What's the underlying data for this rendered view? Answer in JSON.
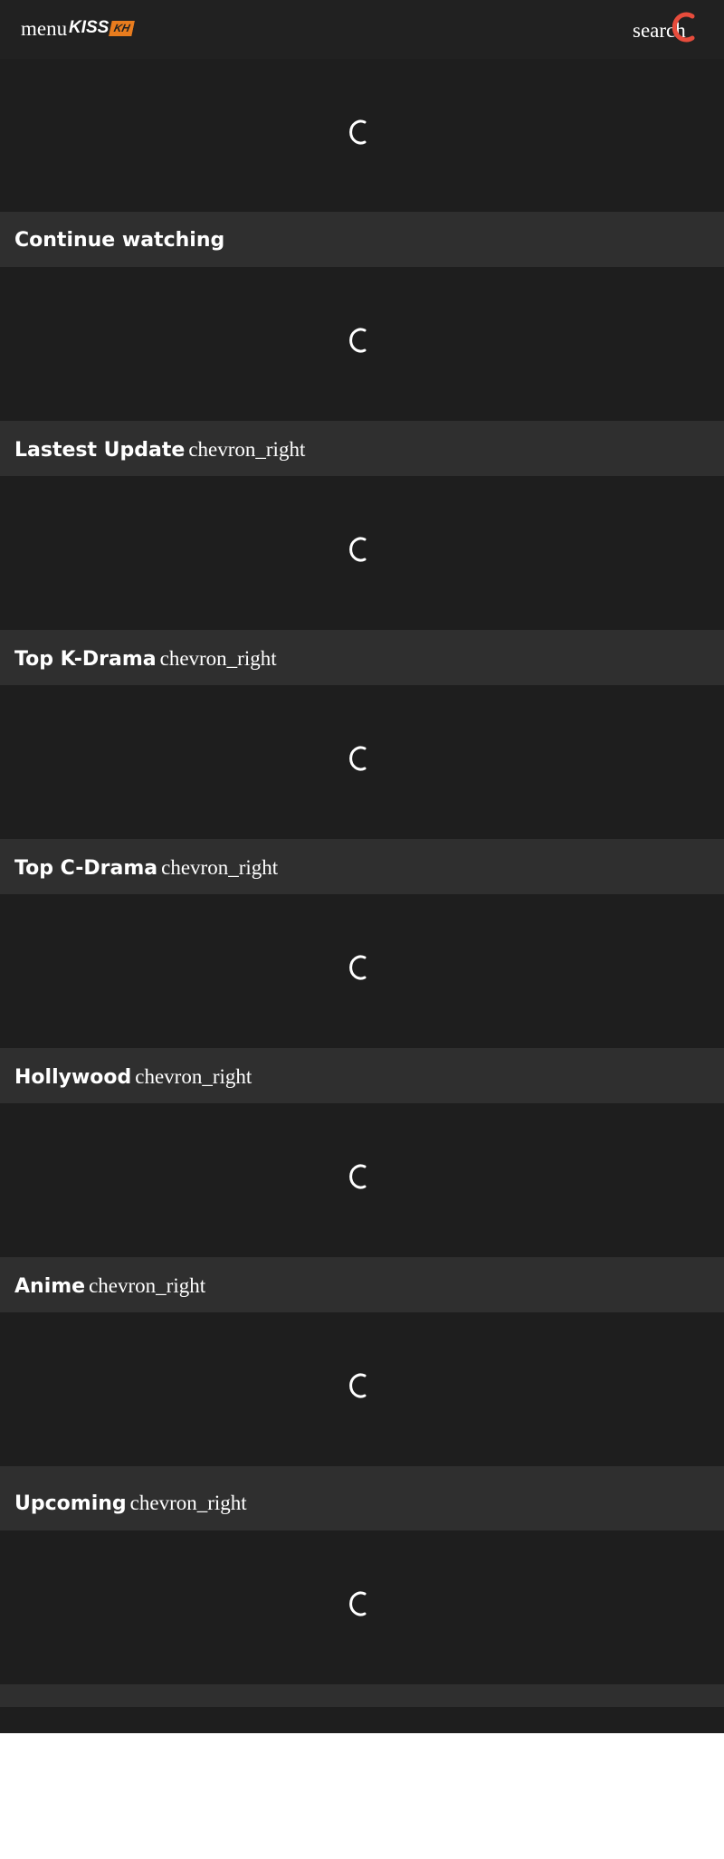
{
  "topbar": {
    "menu_label": "menu",
    "logo": {
      "brand": "KISS",
      "badge": "KH",
      "badge_color": "#e87c1e"
    },
    "search_label": "search",
    "accent_color": "#e74c3c"
  },
  "loader": {
    "icon": "spinner-icon"
  },
  "sections": [
    {
      "title": "Continue watching",
      "chevron": ""
    },
    {
      "title": "Lastest Update",
      "chevron": "chevron_right"
    },
    {
      "title": "Top K-Drama",
      "chevron": "chevron_right"
    },
    {
      "title": "Top C-Drama",
      "chevron": "chevron_right"
    },
    {
      "title": "Hollywood",
      "chevron": "chevron_right"
    },
    {
      "title": "Anime",
      "chevron": "chevron_right"
    },
    {
      "title": "Upcoming",
      "chevron": "chevron_right"
    }
  ]
}
